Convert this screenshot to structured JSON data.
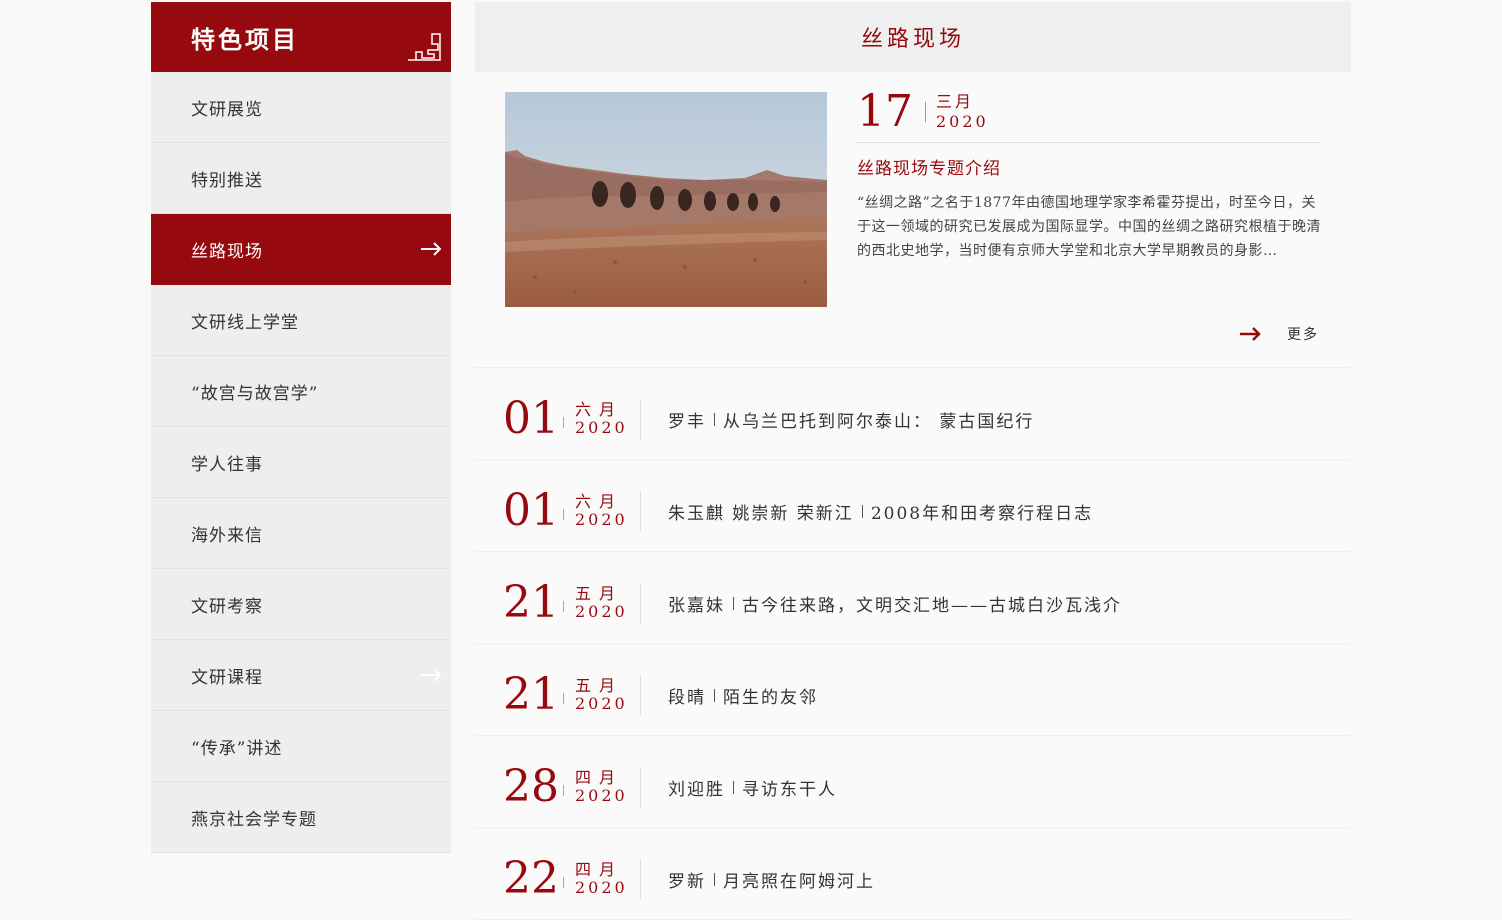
{
  "sidebar": {
    "title": "特色项目",
    "items": [
      {
        "label": "文研展览"
      },
      {
        "label": "特别推送"
      },
      {
        "label": "丝路现场"
      },
      {
        "label": "文研线上学堂"
      },
      {
        "label": "“故宫与故宫学”"
      },
      {
        "label": "学人往事"
      },
      {
        "label": "海外来信"
      },
      {
        "label": "文研考察"
      },
      {
        "label": "文研课程"
      },
      {
        "label": "“传承”讲述"
      },
      {
        "label": "燕京社会学专题"
      }
    ]
  },
  "main": {
    "title": "丝路现场",
    "featured": {
      "day": "17",
      "month": "三月",
      "year": "2020",
      "title": "丝路现场专题介绍",
      "description": "“丝绸之路”之名于1877年由德国地理学家李希霍芬提出，时至今日，关于这一领域的研究已发展成为国际显学。中国的丝绸之路研究根植于晚清的西北史地学，当时便有京师大学堂和北京大学早期教员的身影…",
      "more_label": "更多",
      "image_icon": "ruins-photo"
    },
    "articles": [
      {
        "day": "01",
        "month": "六月",
        "year": "2020",
        "author": "罗丰",
        "title": "从乌兰巴托到阿尔泰山： 蒙古国纪行"
      },
      {
        "day": "01",
        "month": "六月",
        "year": "2020",
        "author": "朱玉麒 姚崇新 荣新江",
        "title": "2008年和田考察行程日志"
      },
      {
        "day": "21",
        "month": "五月",
        "year": "2020",
        "author": "张嘉妹",
        "title": "古今往来路，文明交汇地——古城白沙瓦浅介"
      },
      {
        "day": "21",
        "month": "五月",
        "year": "2020",
        "author": "段晴",
        "title": "陌生的友邻"
      },
      {
        "day": "28",
        "month": "四月",
        "year": "2020",
        "author": "刘迎胜",
        "title": "寻访东干人"
      },
      {
        "day": "22",
        "month": "四月",
        "year": "2020",
        "author": "罗新",
        "title": "月亮照在阿姆河上"
      }
    ]
  },
  "colors": {
    "accent": "#960a0f",
    "sidebar_bg": "#eeeeee",
    "page_bg": "#f9f9f9"
  }
}
